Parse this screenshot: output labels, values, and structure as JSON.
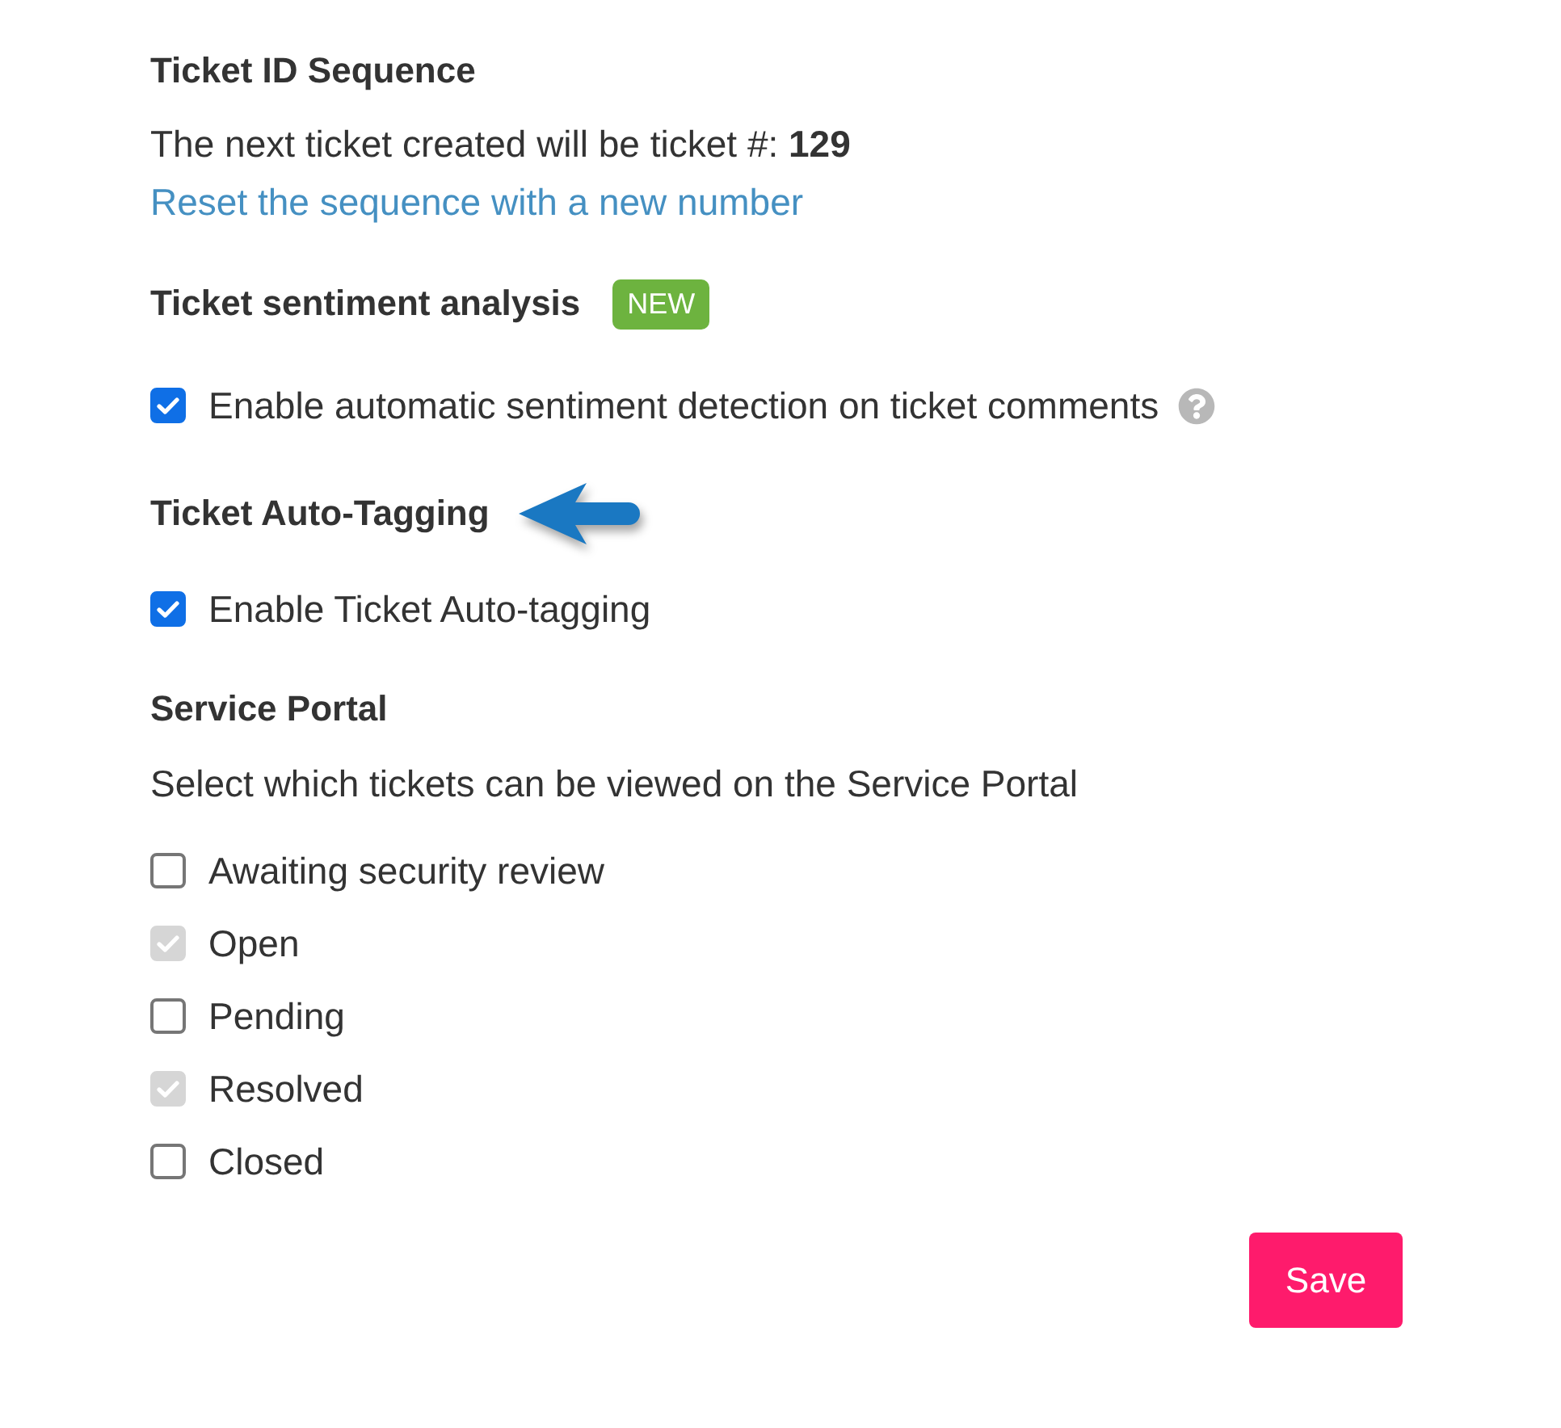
{
  "ticket_id_sequence": {
    "title": "Ticket ID Sequence",
    "text": "The next ticket created will be ticket #: **129**",
    "link": "Reset the sequence with a new number"
  },
  "sentiment_analysis": {
    "title": "Ticket sentiment analysis",
    "badge": "NEW",
    "option": {
      "label": "Enable automatic sentiment detection on ticket comments",
      "checked": true,
      "help": true
    }
  },
  "auto_tagging": {
    "title": "Ticket Auto-Tagging",
    "arrow": true,
    "option": {
      "label": "Enable Ticket Auto-tagging",
      "checked": true
    }
  },
  "service_portal": {
    "title": "Service Portal",
    "description": "Select which tickets can be viewed on the Service Portal",
    "options": [
      {
        "label": "Awaiting security review",
        "checked": false,
        "disabled": false
      },
      {
        "label": "Open",
        "checked": true,
        "disabled": true
      },
      {
        "label": "Pending",
        "checked": false,
        "disabled": false
      },
      {
        "label": "Resolved",
        "checked": true,
        "disabled": true
      },
      {
        "label": "Closed",
        "checked": false,
        "disabled": false
      }
    ]
  },
  "save_button": "Save"
}
